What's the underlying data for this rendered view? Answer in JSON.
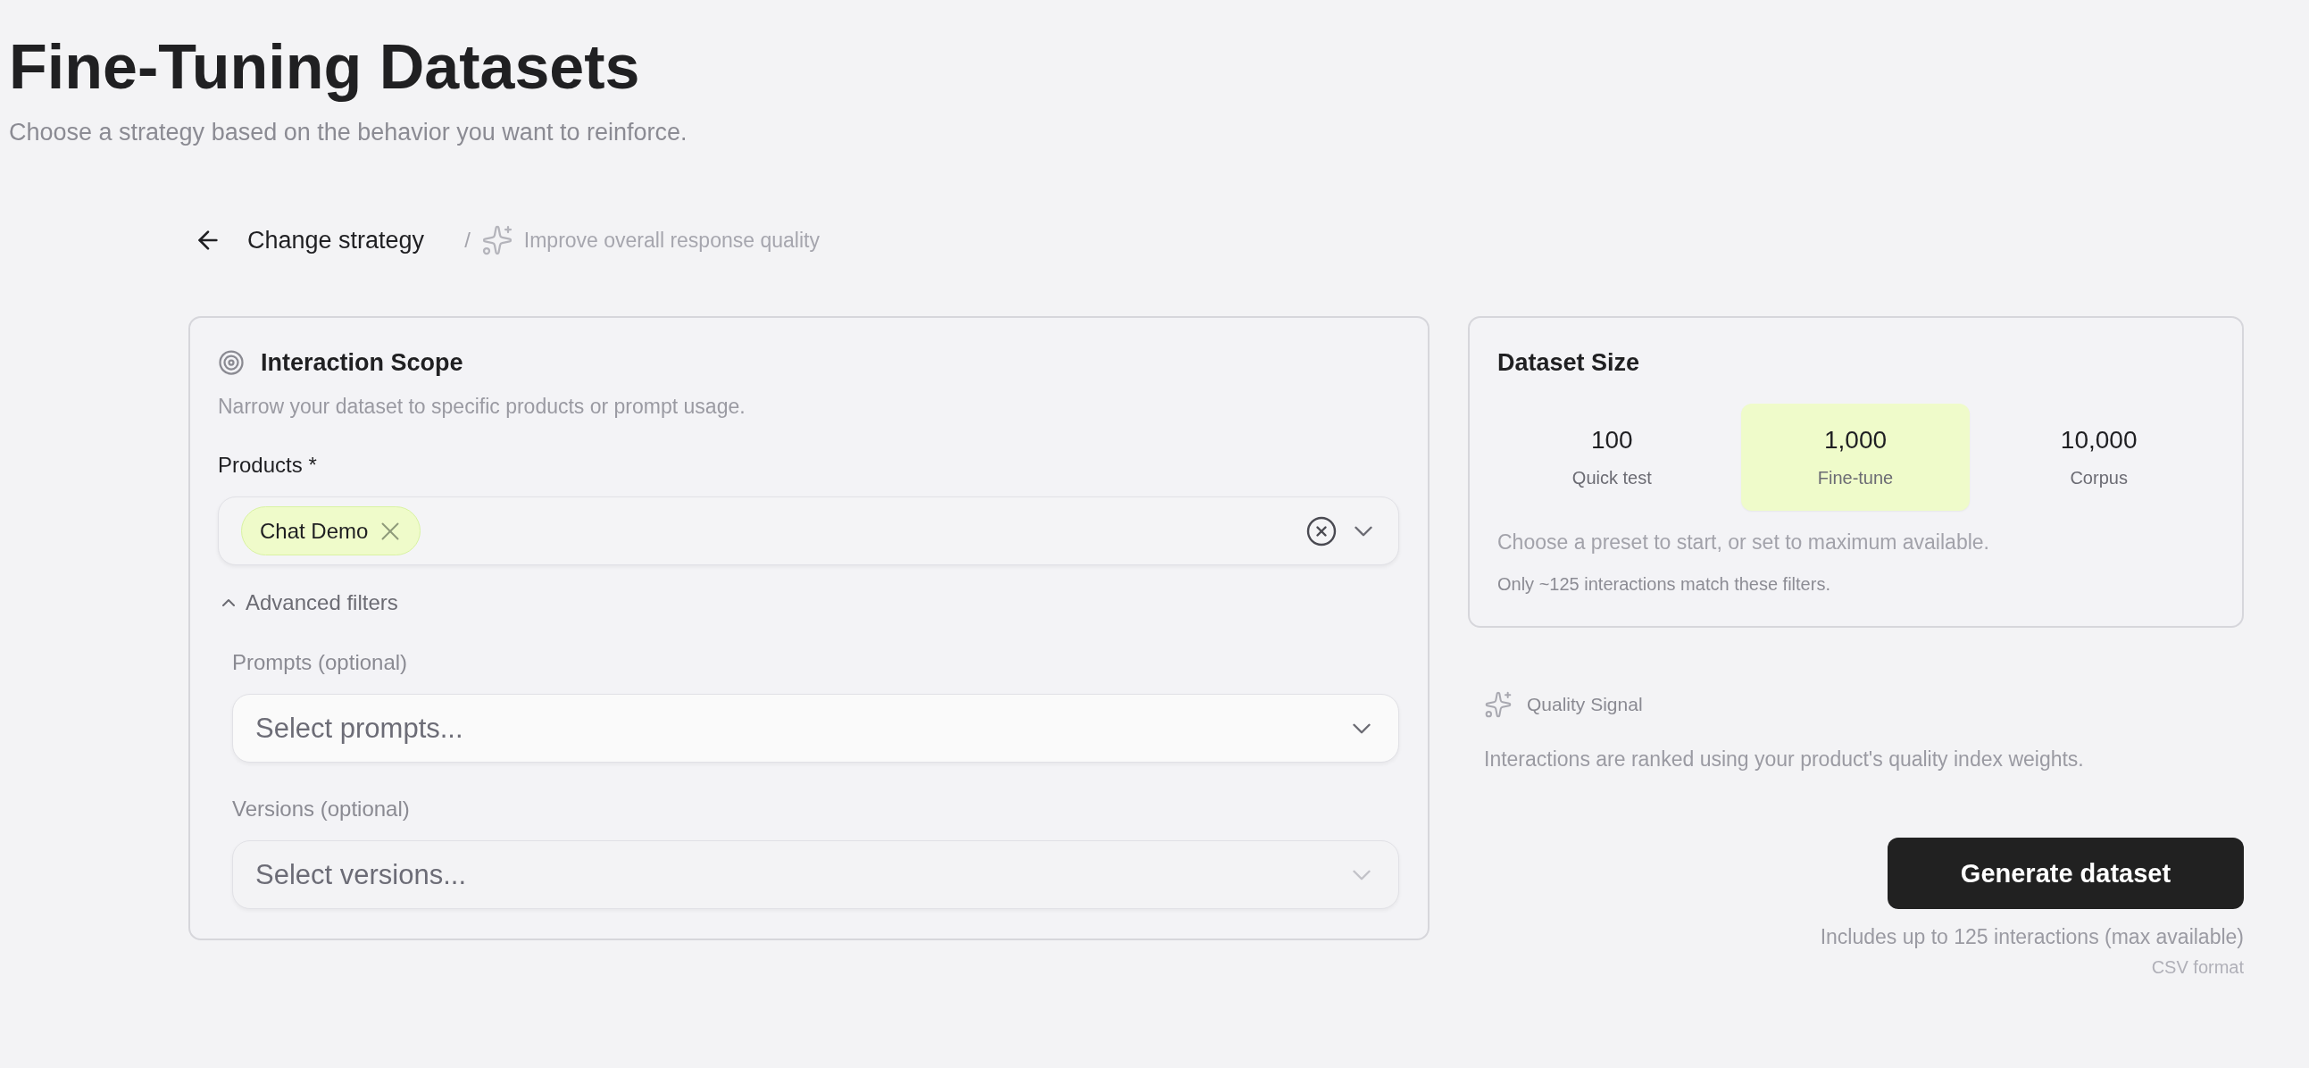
{
  "header": {
    "title": "Fine-Tuning Datasets",
    "subtitle": "Choose a strategy based on the behavior you want to reinforce."
  },
  "breadcrumb": {
    "back": "Change strategy",
    "separator": "/",
    "current": "Improve overall response quality"
  },
  "interaction_scope": {
    "title": "Interaction Scope",
    "description": "Narrow your dataset to specific products or prompt usage.",
    "products": {
      "label": "Products *",
      "chips": [
        {
          "label": "Chat Demo"
        }
      ]
    },
    "advanced_filters": {
      "label": "Advanced filters",
      "expanded": true,
      "fields": [
        {
          "label": "Prompts (optional)",
          "placeholder": "Select prompts...",
          "disabled": false
        },
        {
          "label": "Versions (optional)",
          "placeholder": "Select versions...",
          "disabled": true
        }
      ]
    }
  },
  "dataset_size": {
    "title": "Dataset Size",
    "options": [
      {
        "value": "100",
        "label": "Quick test",
        "selected": false
      },
      {
        "value": "1,000",
        "label": "Fine-tune",
        "selected": true
      },
      {
        "value": "10,000",
        "label": "Corpus",
        "selected": false
      }
    ],
    "hint": "Choose a preset to start, or set to maximum available.",
    "note": "Only ~125 interactions match these filters."
  },
  "quality_signal": {
    "title": "Quality Signal",
    "description": "Interactions are ranked using your product's quality index weights."
  },
  "generate": {
    "button": "Generate dataset",
    "note": "Includes up to 125 interactions (max available)",
    "format": "CSV format"
  }
}
